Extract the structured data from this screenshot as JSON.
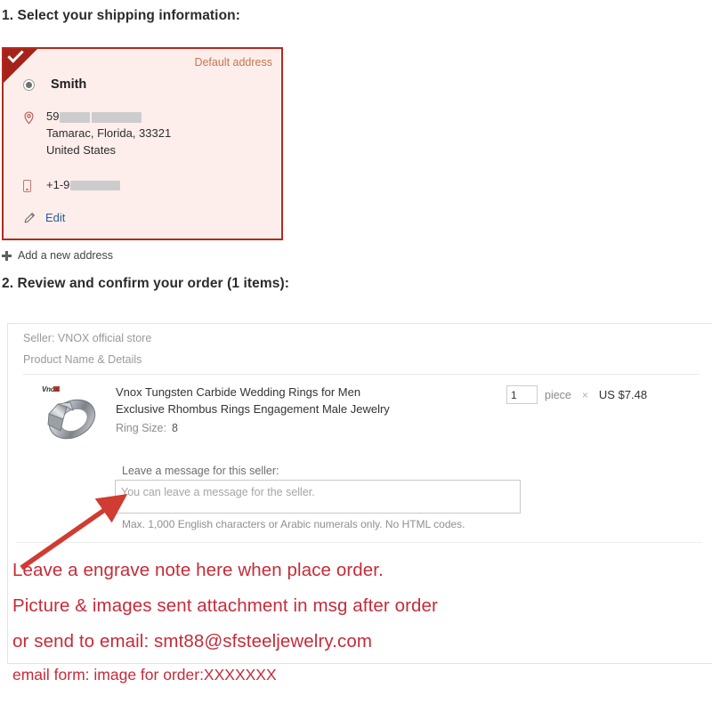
{
  "steps": {
    "step1_heading": "1. Select your shipping information:",
    "step2_heading": "2. Review and confirm your order (1 items):"
  },
  "address_card": {
    "default_badge": "Default address",
    "selected": true,
    "recipient_name": "Smith",
    "street_prefix": "59",
    "city_state_zip": "Tamarac, Florida, 33321",
    "country": "United States",
    "phone_prefix": "+1-9",
    "edit_label": "Edit",
    "border_color": "#b22a1e",
    "background_color": "#fdeeec",
    "badge_color": "#c8754a",
    "link_color": "#2a5b9b"
  },
  "add_address": {
    "label": "Add a new address",
    "icon": "plus-icon"
  },
  "order_panel": {
    "seller_line": "Seller: VNOX official store",
    "product_column_header": "Product Name & Details",
    "product": {
      "title": "Vnox Tungsten Carbide Wedding Rings for Men Exclusive Rhombus Rings Engagement Male Jewelry",
      "thumbnail_watermark": "Vnox",
      "attribute_label": "Ring Size:",
      "attribute_value": "8",
      "quantity": "1",
      "unit": "piece",
      "multiply_symbol": "×",
      "unit_price": "US $7.48"
    },
    "message": {
      "label": "Leave a message for this seller:",
      "value": "",
      "placeholder": "You can leave a message for the seller.",
      "hint": "Max. 1,000 English characters or Arabic numerals only. No HTML codes."
    }
  },
  "annotations": {
    "arrow_color": "#d03b32",
    "text_color": "#c62b39",
    "line1": "Leave a engrave note here when place order.",
    "line2": "Picture & images sent attachment in msg after order",
    "line3": "or send to email: smt88@sfsteeljewelry.com",
    "line4": "email form: image for order:XXXXXXX"
  }
}
